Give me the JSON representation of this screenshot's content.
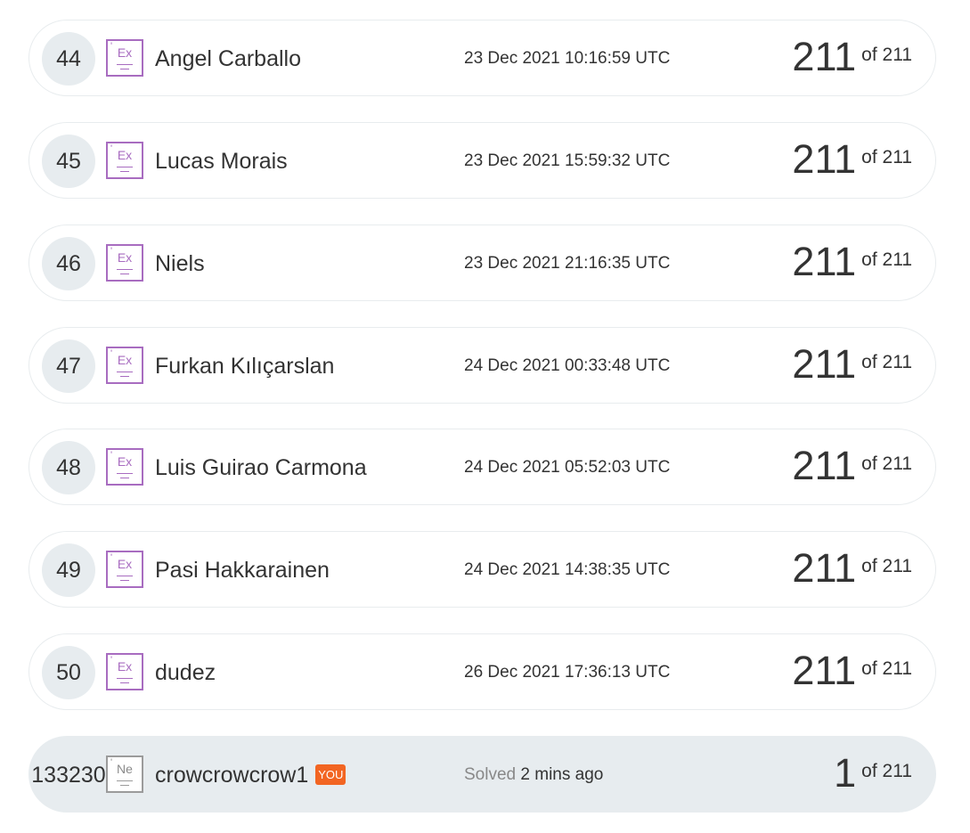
{
  "rows": [
    {
      "rank": "44",
      "level": "Ex",
      "name": "Angel Carballo",
      "date": "23 Dec 2021 10:16:59 UTC",
      "score": "211",
      "of": "of 211"
    },
    {
      "rank": "45",
      "level": "Ex",
      "name": "Lucas Morais",
      "date": "23 Dec 2021 15:59:32 UTC",
      "score": "211",
      "of": "of 211"
    },
    {
      "rank": "46",
      "level": "Ex",
      "name": "Niels",
      "date": "23 Dec 2021 21:16:35 UTC",
      "score": "211",
      "of": "of 211"
    },
    {
      "rank": "47",
      "level": "Ex",
      "name": "Furkan Kılıçarslan",
      "date": "24 Dec 2021 00:33:48 UTC",
      "score": "211",
      "of": "of 211"
    },
    {
      "rank": "48",
      "level": "Ex",
      "name": "Luis Guirao Carmona",
      "date": "24 Dec 2021 05:52:03 UTC",
      "score": "211",
      "of": "of 211"
    },
    {
      "rank": "49",
      "level": "Ex",
      "name": "Pasi Hakkarainen",
      "date": "24 Dec 2021 14:38:35 UTC",
      "score": "211",
      "of": "of 211"
    },
    {
      "rank": "50",
      "level": "Ex",
      "name": "dudez",
      "date": "26 Dec 2021 17:36:13 UTC",
      "score": "211",
      "of": "of 211"
    }
  ],
  "current_user": {
    "rank": "133230",
    "level": "Ne",
    "name": "crowcrowcrow1",
    "you_badge": "YOU",
    "solved_label": "Solved",
    "solved_time": "2 mins ago",
    "score": "1",
    "of": "of 211"
  },
  "colors": {
    "badge_purple": "#a86cc0",
    "badge_grey": "#9b9b9b",
    "you_orange": "#f26522",
    "current_row_bg": "#e7ecef"
  },
  "icons": {
    "level_badge": "level-badge-icon"
  }
}
